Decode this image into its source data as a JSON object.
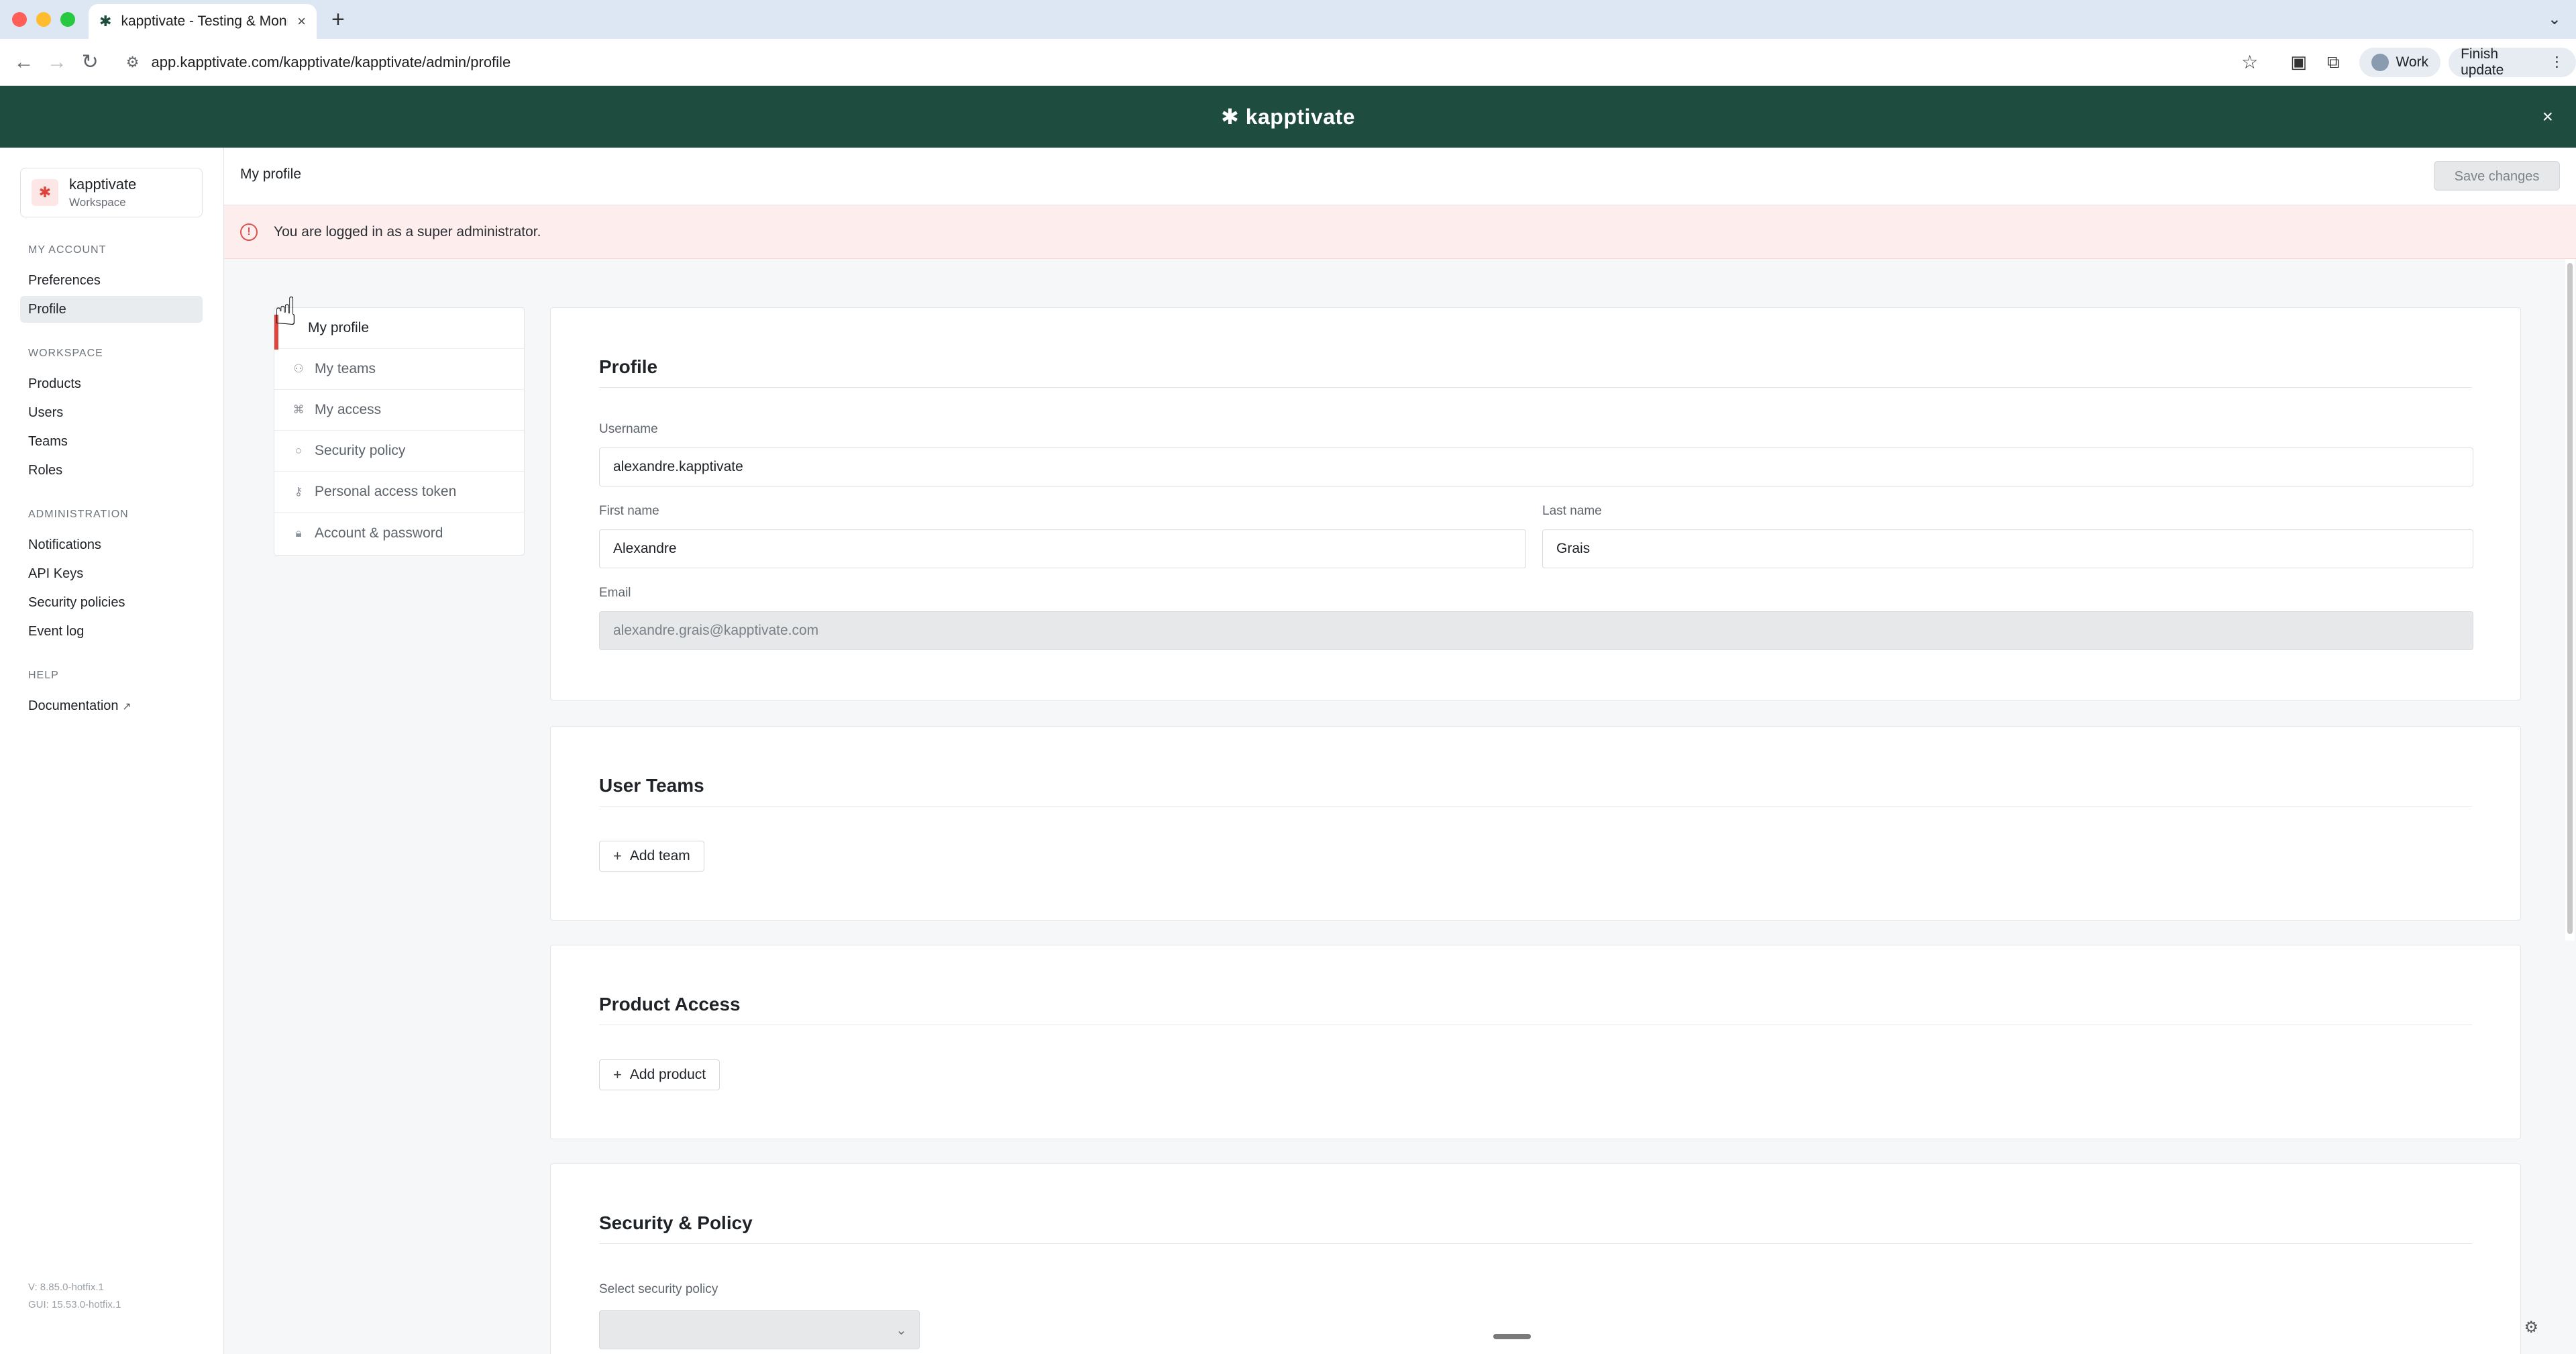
{
  "browser": {
    "tab_title": "kapptivate - Testing & Monit...",
    "tab_close": "×",
    "new_tab": "+",
    "url": "app.kapptivate.com/kapptivate/kapptivate/admin/profile",
    "profile_chip": "Work",
    "update_chip": "Finish update"
  },
  "banner": {
    "brand": "kapptivate",
    "close": "×"
  },
  "workspace": {
    "name": "kapptivate",
    "subtitle": "Workspace"
  },
  "sidebar": {
    "sections": [
      {
        "title": "MY ACCOUNT",
        "items": [
          "Preferences",
          "Profile"
        ]
      },
      {
        "title": "WORKSPACE",
        "items": [
          "Products",
          "Users",
          "Teams",
          "Roles"
        ]
      },
      {
        "title": "ADMINISTRATION",
        "items": [
          "Notifications",
          "API Keys",
          "Security policies",
          "Event log"
        ]
      },
      {
        "title": "HELP",
        "items": [
          "Documentation"
        ]
      }
    ],
    "active_item": "Profile",
    "version_lines": [
      "V: 8.85.0-hotfix.1",
      "GUI: 15.53.0-hotfix.1"
    ]
  },
  "header": {
    "title": "My profile",
    "save_label": "Save changes"
  },
  "alert": {
    "text": "You are logged in as a super administrator."
  },
  "subnav": {
    "items": [
      "My profile",
      "My teams",
      "My access",
      "Security policy",
      "Personal access token",
      "Account & password"
    ],
    "active": "My profile"
  },
  "profile_card": {
    "title": "Profile",
    "username_label": "Username",
    "username_value": "alexandre.kapptivate",
    "first_name_label": "First name",
    "first_name_value": "Alexandre",
    "last_name_label": "Last name",
    "last_name_value": "Grais",
    "email_label": "Email",
    "email_value": "alexandre.grais@kapptivate.com"
  },
  "teams_card": {
    "title": "User Teams",
    "add_label": "Add team"
  },
  "product_card": {
    "title": "Product Access",
    "add_label": "Add product"
  },
  "security_card": {
    "title": "Security & Policy",
    "select_label": "Select security policy",
    "select_value": ""
  },
  "colors": {
    "banner": "#1e4d3f",
    "accent": "#e0433c",
    "alert_bg": "#fdeeed"
  }
}
